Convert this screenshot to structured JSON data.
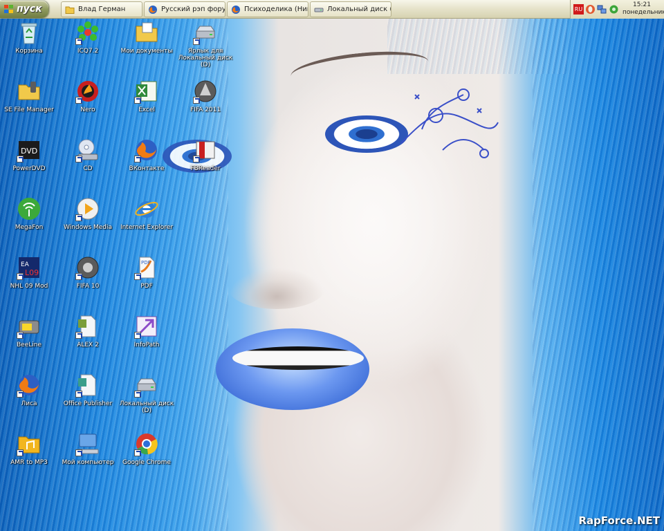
{
  "taskbar": {
    "start_label": "пуск",
    "tasks": [
      {
        "label": "Влад Герман",
        "icon": "folder-icon"
      },
      {
        "label": "Русский рэп форум ...",
        "icon": "firefox-icon"
      },
      {
        "label": "Психоделика (Ник...",
        "icon": "firefox-icon"
      },
      {
        "label": "Локальный диск (D:)",
        "icon": "drive-icon"
      }
    ],
    "tray": {
      "lang": "RU",
      "time": "15:21",
      "day": "понедельник"
    }
  },
  "desktop_icons": [
    {
      "label": "Корзина",
      "icon": "recycle-bin-icon",
      "shortcut": false
    },
    {
      "label": "ICQ7.2",
      "icon": "icq-icon",
      "shortcut": true
    },
    {
      "label": "Мои документы",
      "icon": "my-documents-icon",
      "shortcut": false
    },
    {
      "label": "Ярлык для Локальный диск (D)",
      "icon": "drive-icon",
      "shortcut": true
    },
    {
      "label": "SE File Manager",
      "icon": "file-manager-icon",
      "shortcut": false
    },
    {
      "label": "Nero",
      "icon": "nero-icon",
      "shortcut": true
    },
    {
      "label": "Excel",
      "icon": "excel-icon",
      "shortcut": true
    },
    {
      "label": "FIFA 2011",
      "icon": "fifa-icon",
      "shortcut": true
    },
    {
      "label": "PowerDVD",
      "icon": "powerdvd-icon",
      "shortcut": true
    },
    {
      "label": "CD",
      "icon": "cd-drive-icon",
      "shortcut": true
    },
    {
      "label": "ВКонтакте",
      "icon": "firefox-icon",
      "shortcut": true
    },
    {
      "label": "FBReader",
      "icon": "fbreader-icon",
      "shortcut": true
    },
    {
      "label": "MegaFon",
      "icon": "megafon-icon",
      "shortcut": false
    },
    {
      "label": "Windows Media",
      "icon": "windows-media-icon",
      "shortcut": true
    },
    {
      "label": "Internet Explorer",
      "icon": "internet-explorer-icon",
      "shortcut": false
    },
    {
      "label": "NHL 09 Mod",
      "icon": "nhl-icon",
      "shortcut": true
    },
    {
      "label": "FIFA 10",
      "icon": "fifa-icon",
      "shortcut": true
    },
    {
      "label": "PDF",
      "icon": "pdf-icon",
      "shortcut": true
    },
    {
      "label": "BeeLine",
      "icon": "beeline-icon",
      "shortcut": true
    },
    {
      "label": "ALEX 2",
      "icon": "document-icon",
      "shortcut": true
    },
    {
      "label": "InfoPath",
      "icon": "infopath-icon",
      "shortcut": true
    },
    {
      "label": "Лиса",
      "icon": "firefox-icon",
      "shortcut": true
    },
    {
      "label": "Office Publisher",
      "icon": "publisher-icon",
      "shortcut": true
    },
    {
      "label": "Локальный диск (D)",
      "icon": "drive-icon",
      "shortcut": true
    },
    {
      "label": "AMR to MP3",
      "icon": "music-folder-icon",
      "shortcut": true
    },
    {
      "label": "Мой компьютер",
      "icon": "my-computer-icon",
      "shortcut": true
    },
    {
      "label": "Google Chrome",
      "icon": "chrome-icon",
      "shortcut": true
    }
  ],
  "watermark": "RapForce.NET"
}
